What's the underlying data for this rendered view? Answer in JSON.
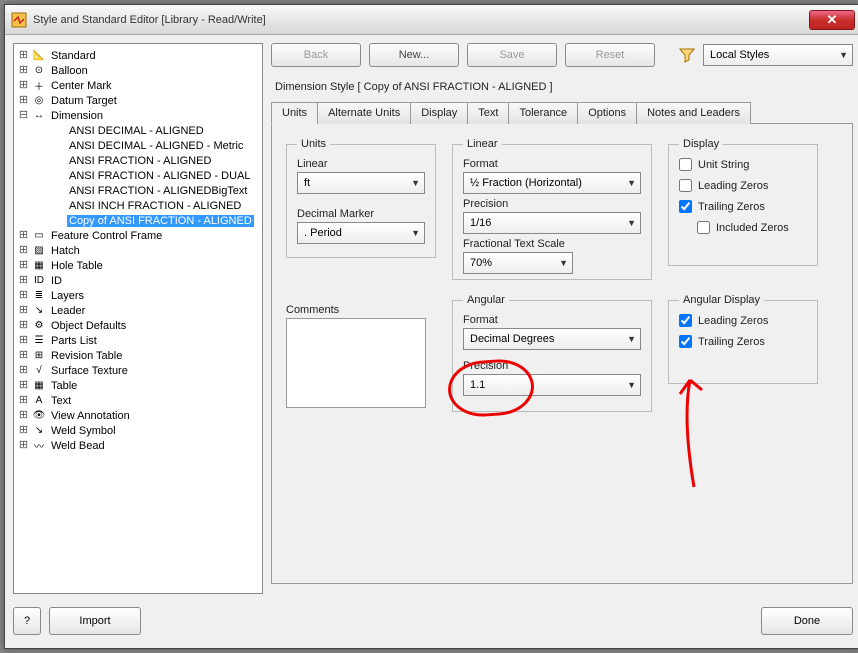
{
  "window": {
    "title": "Style and Standard Editor [Library - Read/Write]"
  },
  "buttons": {
    "back": "Back",
    "new": "New...",
    "save": "Save",
    "reset": "Reset",
    "import": "Import",
    "done": "Done"
  },
  "filter": {
    "value": "Local Styles"
  },
  "style_heading": "Dimension Style [ Copy of ANSI FRACTION - ALIGNED ]",
  "tabs": [
    "Units",
    "Alternate Units",
    "Display",
    "Text",
    "Tolerance",
    "Options",
    "Notes and Leaders"
  ],
  "active_tab": 0,
  "units_group": {
    "title": "Units",
    "linear_label": "Linear",
    "linear_value": "ft",
    "marker_label": "Decimal Marker",
    "marker_value": ". Period"
  },
  "linear_group": {
    "title": "Linear",
    "format_label": "Format",
    "format_value": "½  Fraction (Horizontal)",
    "precision_label": "Precision",
    "precision_value": "1/16",
    "scale_label": "Fractional Text Scale",
    "scale_value": "70%"
  },
  "display_group": {
    "title": "Display",
    "unit_string": "Unit String",
    "leading": "Leading Zeros",
    "trailing": "Trailing Zeros",
    "included": "Included Zeros",
    "unit_string_chk": false,
    "leading_chk": false,
    "trailing_chk": true,
    "included_chk": false
  },
  "comments_label": "Comments",
  "angular_group": {
    "title": "Angular",
    "format_label": "Format",
    "format_value": "Decimal Degrees",
    "precision_label": "Precision",
    "precision_value": "1.1"
  },
  "angular_display_group": {
    "title": "Angular Display",
    "leading": "Leading Zeros",
    "trailing": "Trailing Zeros",
    "leading_chk": true,
    "trailing_chk": true
  },
  "tree": [
    {
      "lvl": 0,
      "exp": "+",
      "icon": "std",
      "label": "Standard"
    },
    {
      "lvl": 0,
      "exp": "+",
      "icon": "bal",
      "label": "Balloon"
    },
    {
      "lvl": 0,
      "exp": "+",
      "icon": "cm",
      "label": "Center Mark"
    },
    {
      "lvl": 0,
      "exp": "+",
      "icon": "dt",
      "label": "Datum Target"
    },
    {
      "lvl": 0,
      "exp": "-",
      "icon": "dim",
      "label": "Dimension"
    },
    {
      "lvl": 1,
      "exp": "",
      "icon": "",
      "label": "ANSI DECIMAL - ALIGNED"
    },
    {
      "lvl": 1,
      "exp": "",
      "icon": "",
      "label": "ANSI DECIMAL - ALIGNED - Metric"
    },
    {
      "lvl": 1,
      "exp": "",
      "icon": "",
      "label": "ANSI FRACTION - ALIGNED"
    },
    {
      "lvl": 1,
      "exp": "",
      "icon": "",
      "label": "ANSI FRACTION - ALIGNED - DUAL"
    },
    {
      "lvl": 1,
      "exp": "",
      "icon": "",
      "label": "ANSI FRACTION - ALIGNEDBigText"
    },
    {
      "lvl": 1,
      "exp": "",
      "icon": "",
      "label": "ANSI INCH FRACTION - ALIGNED"
    },
    {
      "lvl": 1,
      "exp": "",
      "icon": "",
      "label": "Copy of ANSI FRACTION - ALIGNED",
      "sel": true
    },
    {
      "lvl": 0,
      "exp": "+",
      "icon": "fcf",
      "label": "Feature Control Frame"
    },
    {
      "lvl": 0,
      "exp": "+",
      "icon": "hat",
      "label": "Hatch"
    },
    {
      "lvl": 0,
      "exp": "+",
      "icon": "ht",
      "label": "Hole Table"
    },
    {
      "lvl": 0,
      "exp": "+",
      "icon": "id",
      "label": "ID"
    },
    {
      "lvl": 0,
      "exp": "+",
      "icon": "lay",
      "label": "Layers"
    },
    {
      "lvl": 0,
      "exp": "+",
      "icon": "ldr",
      "label": "Leader"
    },
    {
      "lvl": 0,
      "exp": "+",
      "icon": "od",
      "label": "Object Defaults"
    },
    {
      "lvl": 0,
      "exp": "+",
      "icon": "pl",
      "label": "Parts List"
    },
    {
      "lvl": 0,
      "exp": "+",
      "icon": "rt",
      "label": "Revision Table"
    },
    {
      "lvl": 0,
      "exp": "+",
      "icon": "st",
      "label": "Surface Texture"
    },
    {
      "lvl": 0,
      "exp": "+",
      "icon": "tb",
      "label": "Table"
    },
    {
      "lvl": 0,
      "exp": "+",
      "icon": "tx",
      "label": "Text"
    },
    {
      "lvl": 0,
      "exp": "+",
      "icon": "va",
      "label": "View Annotation"
    },
    {
      "lvl": 0,
      "exp": "+",
      "icon": "ws",
      "label": "Weld Symbol"
    },
    {
      "lvl": 0,
      "exp": "+",
      "icon": "wb",
      "label": "Weld Bead"
    }
  ],
  "icons": {
    "std": "📐",
    "bal": "⊙",
    "cm": "＋",
    "dt": "◎",
    "dim": "↔",
    "fcf": "▭",
    "hat": "▨",
    "ht": "▦",
    "id": "ID",
    "lay": "≣",
    "ldr": "↘",
    "od": "⚙",
    "pl": "☰",
    "rt": "⊞",
    "st": "√",
    "tb": "▦",
    "tx": "A",
    "va": "👁",
    "ws": "↘",
    "wb": "〰"
  }
}
